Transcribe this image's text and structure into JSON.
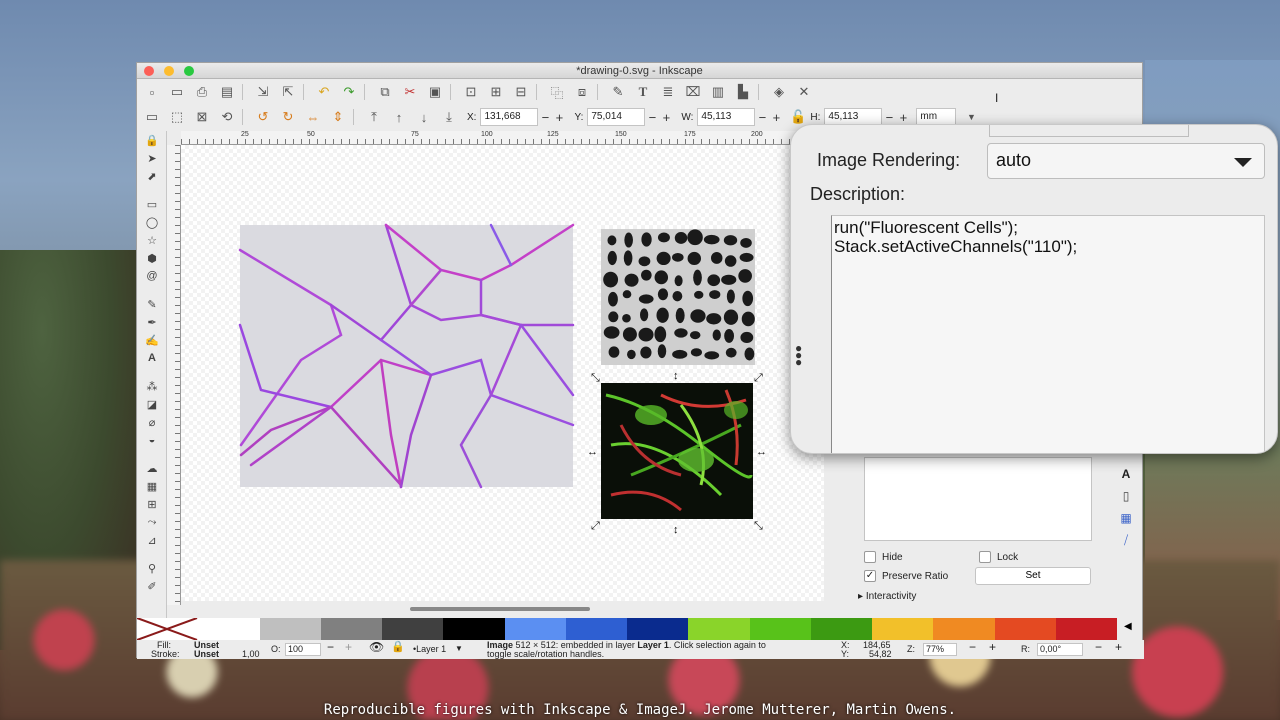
{
  "window": {
    "title": "*drawing-0.svg - Inkscape"
  },
  "toolbar2": {
    "x_label": "X:",
    "x_value": "131,668",
    "y_label": "Y:",
    "y_value": "75,014",
    "w_label": "W:",
    "w_value": "45,113",
    "h_label": "H:",
    "h_value": "45,113",
    "unit": "mm",
    "minus": "−",
    "plus": "+"
  },
  "ruler": {
    "ticks": [
      "25",
      "50",
      "75",
      "100",
      "125",
      "150",
      "175",
      "200"
    ]
  },
  "palette": [
    "#ffffff",
    "#bfbfbf",
    "#808080",
    "#404040",
    "#000000",
    "#5b8ff2",
    "#2e5fd2",
    "#0a2b8e",
    "#8ad42a",
    "#58c21a",
    "#3c9a12",
    "#f2c02a",
    "#f08a22",
    "#e44a22",
    "#c81e24"
  ],
  "status": {
    "fill_label": "Fill:",
    "fill_value": "Unset",
    "stroke_label": "Stroke:",
    "stroke_value": "Unset",
    "stroke_width": "1,00",
    "opacity_label": "O:",
    "opacity_value": "100",
    "layer": "•Layer 1",
    "message_bold": "Image",
    "message_a": " 512 × 512: embedded in layer ",
    "message_layer": "Layer 1",
    "message_b": ". Click selection again to",
    "message_c": "toggle scale/rotation handles.",
    "x_label": "X:",
    "x_value": "184,65",
    "y_label": "Y:",
    "y_value": "54,82",
    "z_label": "Z:",
    "zoom_value": "77%",
    "r_label": "R:",
    "rotation_value": "0,00°"
  },
  "panel": {
    "image_rendering_label": "Image Rendering:",
    "image_rendering_value": "auto",
    "description_label": "Description:",
    "description_lines": [
      "run(\"Fluorescent Cells\");",
      "Stack.setActiveChannels(\"110\");"
    ],
    "hide_label": "Hide",
    "lock_label": "Lock",
    "preserve_ratio_label": "Preserve Ratio",
    "set_button": "Set",
    "interactivity_label": "Interactivity"
  },
  "caption": "Reproducible figures with Inkscape & ImageJ. Jerome Mutterer, Martin Owens."
}
